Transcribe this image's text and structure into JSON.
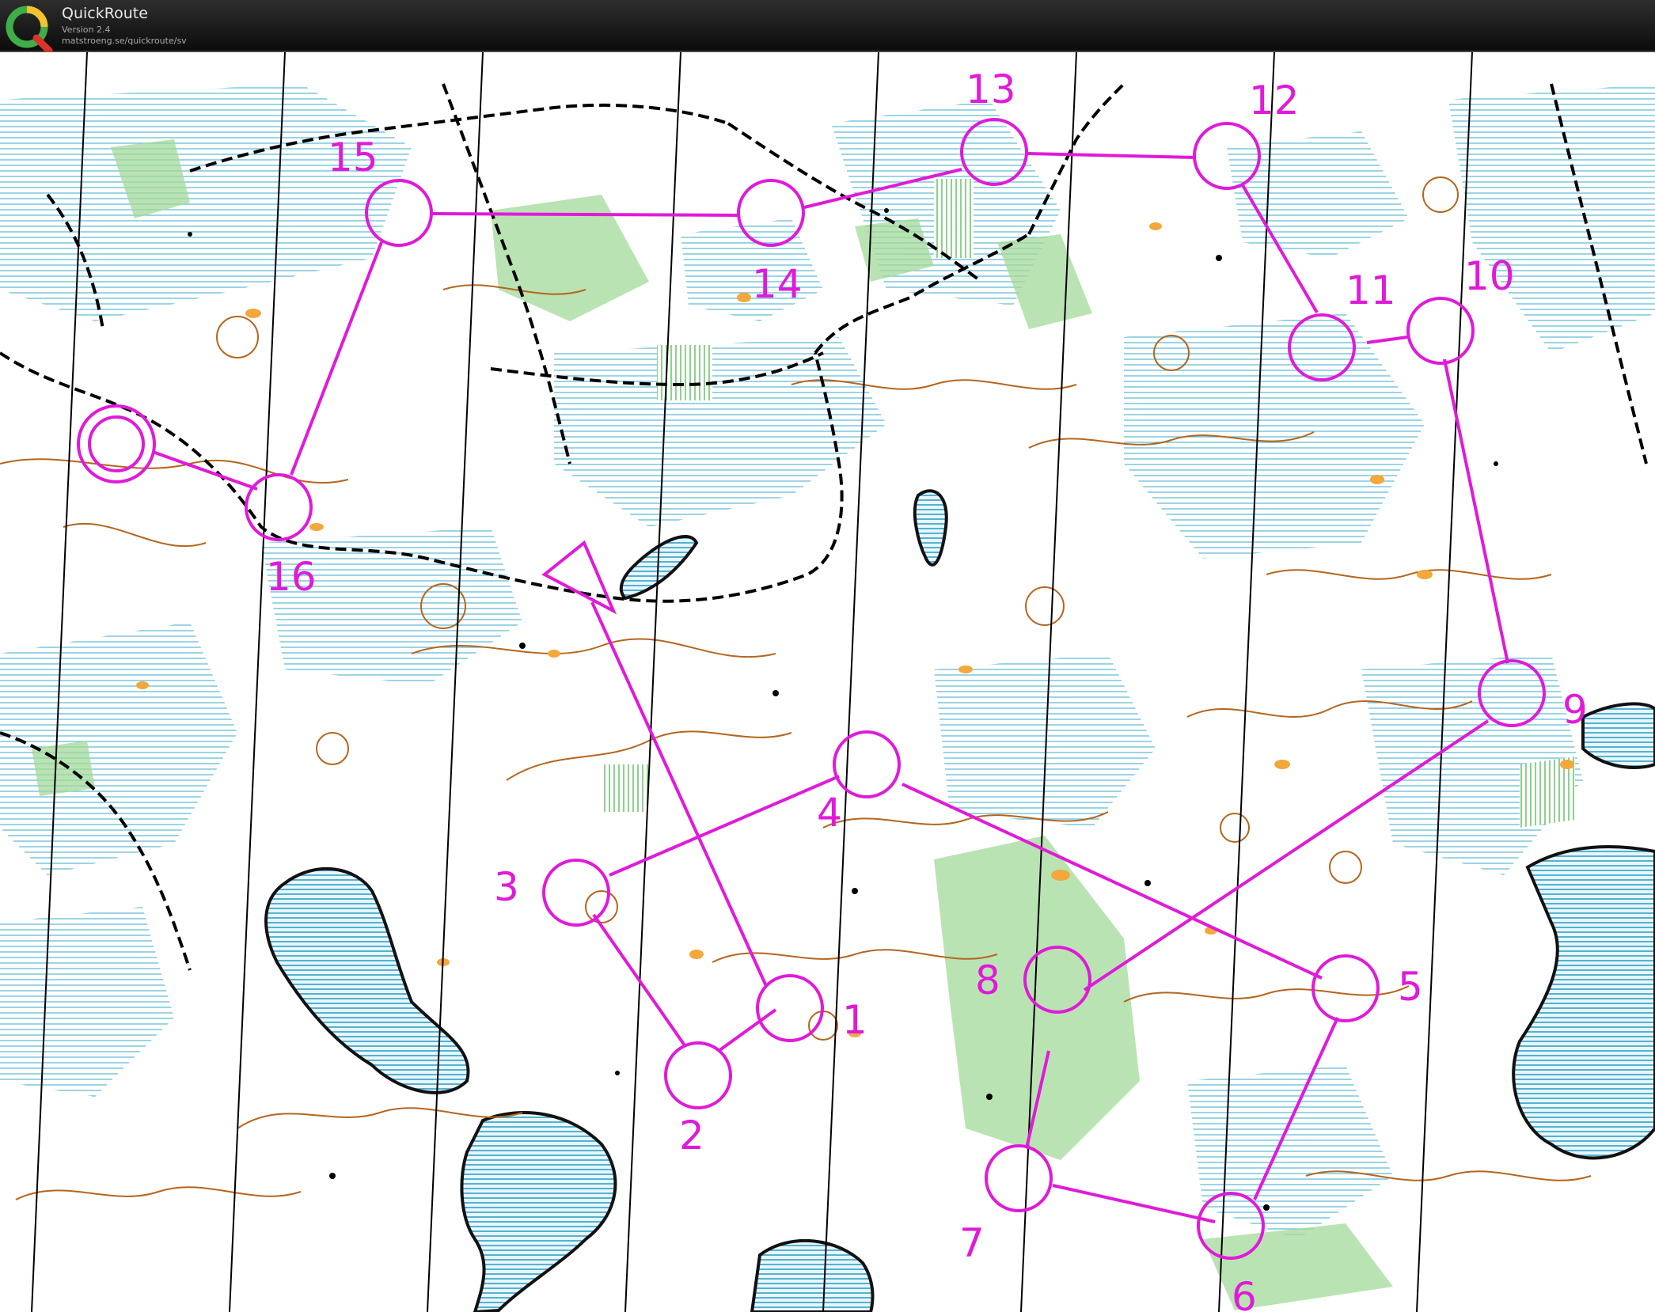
{
  "app": {
    "title": "QuickRoute",
    "version": "Version 2.4",
    "url": "matstroeng.se/quickroute/sv"
  },
  "colors": {
    "course": "#e01ad9",
    "water": "#2ea1c5",
    "vegetation": "#a3d99a",
    "contour": "#b5651d",
    "rock": "#f2a83a",
    "path": "#000000",
    "map_bg": "#ffffff"
  },
  "course": {
    "start_label": "start-triangle",
    "finish_label": "finish-circle",
    "controls": [
      {
        "number": "1"
      },
      {
        "number": "2"
      },
      {
        "number": "3"
      },
      {
        "number": "4"
      },
      {
        "number": "5"
      },
      {
        "number": "6"
      },
      {
        "number": "7"
      },
      {
        "number": "8"
      },
      {
        "number": "9"
      },
      {
        "number": "10"
      },
      {
        "number": "11"
      },
      {
        "number": "12"
      },
      {
        "number": "13"
      },
      {
        "number": "14"
      },
      {
        "number": "15"
      },
      {
        "number": "16"
      }
    ]
  }
}
